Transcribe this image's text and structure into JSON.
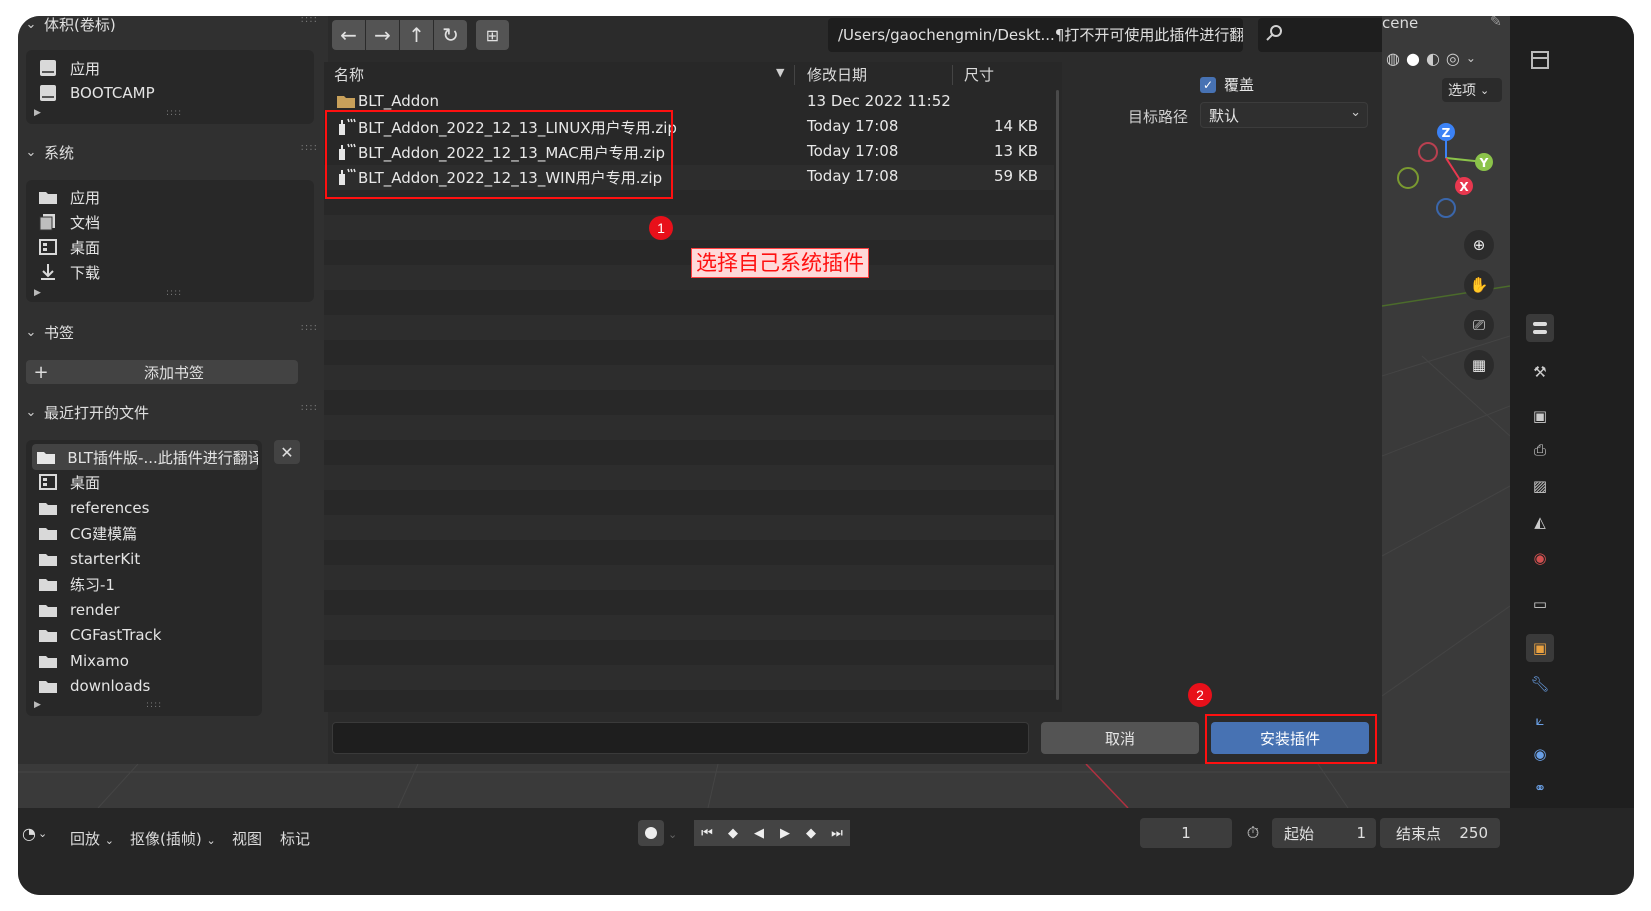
{
  "sidebar": {
    "volumes": {
      "title": "体积(卷标)",
      "items": [
        {
          "label": "应用"
        },
        {
          "label": "BOOTCAMP"
        }
      ]
    },
    "system": {
      "title": "系统",
      "items": [
        {
          "label": "应用"
        },
        {
          "label": "文档"
        },
        {
          "label": "桌面"
        },
        {
          "label": "下载"
        }
      ]
    },
    "bookmarks": {
      "title": "书签",
      "add_label": "添加书签"
    },
    "recent": {
      "title": "最近打开的文件",
      "items": [
        {
          "label": "BLT插件版-...此插件进行翻译"
        },
        {
          "label": "桌面"
        },
        {
          "label": "references"
        },
        {
          "label": "CG建模篇"
        },
        {
          "label": "starterKit"
        },
        {
          "label": "练习-1"
        },
        {
          "label": "render"
        },
        {
          "label": "CGFastTrack"
        },
        {
          "label": "Mixamo"
        },
        {
          "label": "downloads"
        }
      ]
    }
  },
  "toolbar": {
    "path": "/Users/gaochengmin/Deskt...¶打不开可使用此插件进行翻译/",
    "search_placeholder": ""
  },
  "filelist": {
    "columns": {
      "name": "名称",
      "date": "修改日期",
      "size": "尺寸"
    },
    "files": [
      {
        "name": "BLT_Addon",
        "date": "13 Dec 2022 11:52",
        "size": "",
        "type": "folder"
      },
      {
        "name": "BLT_Addon_2022_12_13_LINUX用户专用.zip",
        "date": "Today 17:08",
        "size": "14 KB",
        "type": "zip"
      },
      {
        "name": "BLT_Addon_2022_12_13_MAC用户专用.zip",
        "date": "Today 17:08",
        "size": "13 KB",
        "type": "zip"
      },
      {
        "name": "BLT_Addon_2022_12_13_WIN用户专用.zip",
        "date": "Today 17:08",
        "size": "59 KB",
        "type": "zip"
      }
    ]
  },
  "options": {
    "overwrite_label": "覆盖",
    "overwrite_checked": true,
    "target_path_label": "目标路径",
    "target_path_value": "默认"
  },
  "buttons": {
    "cancel": "取消",
    "install": "安装插件"
  },
  "viewport": {
    "scene_label": "cene",
    "options_label": "选项",
    "axes": {
      "z": "Z",
      "y": "Y",
      "x": "X"
    }
  },
  "timeline": {
    "playback": "回放",
    "keying": "抠像(插帧)",
    "view": "视图",
    "marker": "标记",
    "current_frame": "1",
    "start_label": "起始",
    "start_value": "1",
    "end_label": "结束点",
    "end_value": "250"
  },
  "annotations": {
    "step1_number": "1",
    "step1_text": "选择自己系统插件",
    "step2_number": "2"
  },
  "colors": {
    "accent_blue": "#4772b3",
    "annotation_red": "#ff1010",
    "axis_x": "#e8384f",
    "axis_y": "#8bc34a",
    "axis_z": "#3b82f6"
  }
}
